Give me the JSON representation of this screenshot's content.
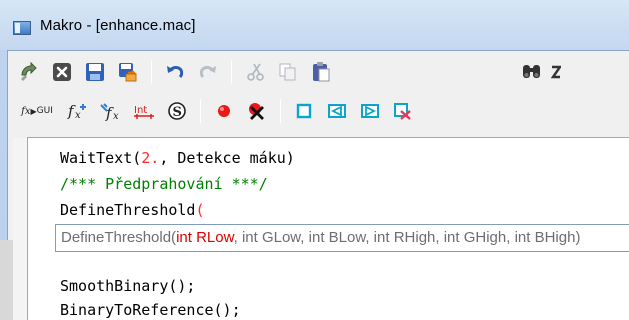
{
  "window": {
    "title": "Makro - [enhance.mac]"
  },
  "toolbar1": {
    "buttons": [
      {
        "name": "run-icon"
      },
      {
        "name": "close-icon"
      },
      {
        "name": "save-icon"
      },
      {
        "name": "save-as-icon"
      },
      {
        "name": "undo-icon"
      },
      {
        "name": "redo-icon"
      },
      {
        "name": "cut-icon"
      },
      {
        "name": "copy-icon"
      },
      {
        "name": "paste-icon"
      },
      {
        "name": "find-icon"
      }
    ]
  },
  "toolbar2": {
    "fx_gui_label_fx": "fx",
    "fx_gui_label_gui": "GUI",
    "buttons": [
      {
        "name": "insert-function-icon"
      },
      {
        "name": "edit-function-icon"
      },
      {
        "name": "integer-icon"
      },
      {
        "name": "string-icon"
      },
      {
        "name": "record-icon"
      },
      {
        "name": "stop-record-icon"
      },
      {
        "name": "step-icon"
      },
      {
        "name": "step-back-icon"
      },
      {
        "name": "step-forward-icon"
      },
      {
        "name": "clear-breakpoints-icon"
      }
    ]
  },
  "editor": {
    "line1_func": "WaitText(",
    "line1_num": "2.",
    "line1_rest": ", Detekce máku)",
    "line2": "/*** Předprahování ***/",
    "line3_func": "DefineThreshold",
    "line3_paren": "(",
    "line4": "SmoothBinary();",
    "line5": "BinaryToReference();"
  },
  "tooltip": {
    "prefix": "DefineThreshold(",
    "highlight": "int RLow",
    "suffix": ", int GLow, int BLow, int RHigh, int GHigh, int BHigh)"
  },
  "colors": {
    "comment": "#008000",
    "number": "#ff2b2b",
    "tooltip_highlight": "#e00000"
  }
}
